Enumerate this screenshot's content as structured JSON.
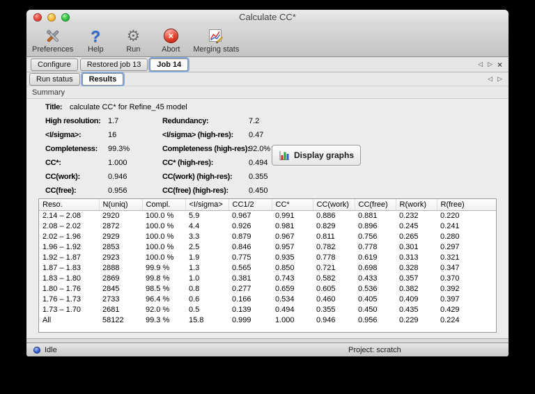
{
  "window": {
    "title": "Calculate CC*"
  },
  "toolbar": {
    "items": [
      {
        "label": "Preferences"
      },
      {
        "label": "Help"
      },
      {
        "label": "Run"
      },
      {
        "label": "Abort"
      },
      {
        "label": "Merging stats"
      }
    ]
  },
  "tabs": {
    "items": [
      {
        "label": "Configure"
      },
      {
        "label": "Restored job 13"
      },
      {
        "label": "Job 14"
      }
    ],
    "nav": {
      "left": "◁",
      "right": "▷",
      "close": "×"
    }
  },
  "subtabs": {
    "items": [
      {
        "label": "Run status"
      },
      {
        "label": "Results"
      }
    ],
    "nav": {
      "left": "◁",
      "right": "▷"
    }
  },
  "section": {
    "label": "Summary"
  },
  "summary": {
    "title_label": "Title:",
    "title_value": "calculate CC* for Refine_45 model",
    "rows": [
      {
        "left_label": "High resolution:",
        "left_value": "1.7",
        "right_label": "Redundancy:",
        "right_value": "7.2"
      },
      {
        "left_label": "<I/sigma>:",
        "left_value": "16",
        "right_label": "<I/sigma> (high-res):",
        "right_value": "0.47"
      },
      {
        "left_label": "Completeness:",
        "left_value": "99.3%",
        "right_label": "Completeness (high-res):",
        "right_value": "92.0%"
      },
      {
        "left_label": "CC*:",
        "left_value": "1.000",
        "right_label": "CC* (high-res):",
        "right_value": "0.494"
      },
      {
        "left_label": "CC(work):",
        "left_value": "0.946",
        "right_label": "CC(work) (high-res):",
        "right_value": "0.355"
      },
      {
        "left_label": "CC(free):",
        "left_value": "0.956",
        "right_label": "CC(free) (high-res):",
        "right_value": "0.450"
      }
    ],
    "display_graphs_label": "Display graphs"
  },
  "table": {
    "columns": [
      "Reso.",
      "N(uniq)",
      "Compl.",
      "<I/sigma>",
      "CC1/2",
      "CC*",
      "CC(work)",
      "CC(free)",
      "R(work)",
      "R(free)"
    ],
    "rows": [
      [
        "2.14 – 2.08",
        "2920",
        "100.0 %",
        "5.9",
        "0.967",
        "0.991",
        "0.886",
        "0.881",
        "0.232",
        "0.220"
      ],
      [
        "2.08 – 2.02",
        "2872",
        "100.0 %",
        "4.4",
        "0.926",
        "0.981",
        "0.829",
        "0.896",
        "0.245",
        "0.241"
      ],
      [
        "2.02 – 1.96",
        "2929",
        "100.0 %",
        "3.3",
        "0.879",
        "0.967",
        "0.811",
        "0.756",
        "0.265",
        "0.280"
      ],
      [
        "1.96 – 1.92",
        "2853",
        "100.0 %",
        "2.5",
        "0.846",
        "0.957",
        "0.782",
        "0.778",
        "0.301",
        "0.297"
      ],
      [
        "1.92 – 1.87",
        "2923",
        "100.0 %",
        "1.9",
        "0.775",
        "0.935",
        "0.778",
        "0.619",
        "0.313",
        "0.321"
      ],
      [
        "1.87 – 1.83",
        "2888",
        "99.9 %",
        "1.3",
        "0.565",
        "0.850",
        "0.721",
        "0.698",
        "0.328",
        "0.347"
      ],
      [
        "1.83 – 1.80",
        "2869",
        "99.8 %",
        "1.0",
        "0.381",
        "0.743",
        "0.582",
        "0.433",
        "0.357",
        "0.370"
      ],
      [
        "1.80 – 1.76",
        "2845",
        "98.5 %",
        "0.8",
        "0.277",
        "0.659",
        "0.605",
        "0.536",
        "0.382",
        "0.392"
      ],
      [
        "1.76 – 1.73",
        "2733",
        "96.4 %",
        "0.6",
        "0.166",
        "0.534",
        "0.460",
        "0.405",
        "0.409",
        "0.397"
      ],
      [
        "1.73 – 1.70",
        "2681",
        "92.0 %",
        "0.5",
        "0.139",
        "0.494",
        "0.355",
        "0.450",
        "0.435",
        "0.429"
      ],
      [
        "All",
        "58122",
        "99.3 %",
        "15.8",
        "0.999",
        "1.000",
        "0.946",
        "0.956",
        "0.229",
        "0.224"
      ]
    ]
  },
  "statusbar": {
    "status_label": "Idle",
    "project_label": "Project: scratch"
  }
}
